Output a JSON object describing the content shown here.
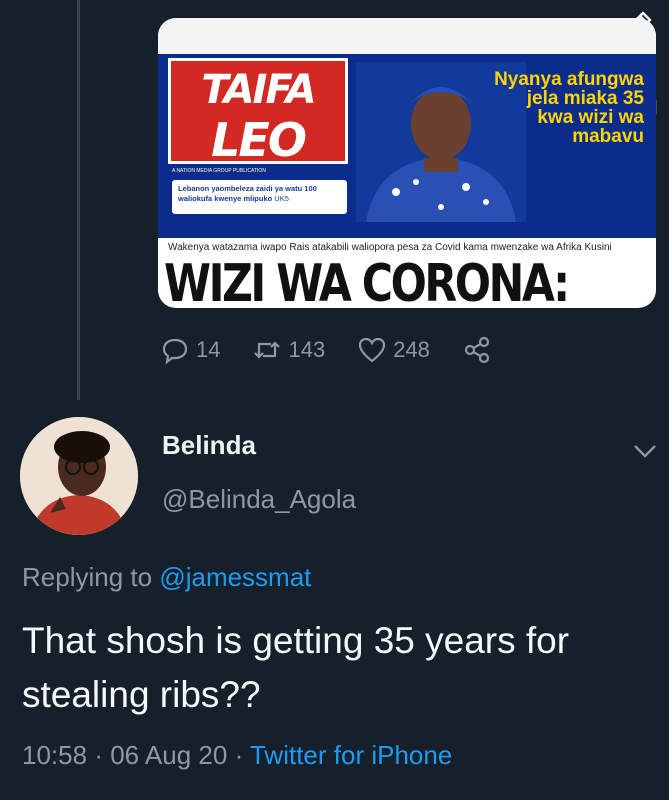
{
  "embedded_image": {
    "logo_line1": "TAIFA",
    "logo_line2": "LEO",
    "tagline": "A NATION MEDIA GROUP PUBLICATION",
    "teaser": "Lebanon yaombeleza zaidi ya watu 100 waliokufa kwenye mlipuko",
    "teaser_page": "UK5",
    "headline_right": "Nyanya afungwa jela miaka 35 kwa wizi wa mabavu",
    "subhead": "Wakenya watazama iwapo Rais atakabili waliopora pesa za Covid kama mwenzake wa Afrika Kusini",
    "big_headline": "WIZI WA CORONA:"
  },
  "quoted_actions": {
    "replies": "14",
    "retweets": "143",
    "likes": "248"
  },
  "reply_tweet": {
    "display_name": "Belinda",
    "handle": "@Belinda_Agola",
    "replying_label": "Replying to",
    "replying_to": "@jamessmat",
    "text": "That shosh is getting 35 years for stealing ribs??",
    "time": "10:58",
    "date": "06 Aug 20",
    "source": "Twitter for iPhone"
  },
  "colors": {
    "background": "#15202b",
    "accent": "#1d9bf0",
    "muted": "#8b98a5"
  }
}
